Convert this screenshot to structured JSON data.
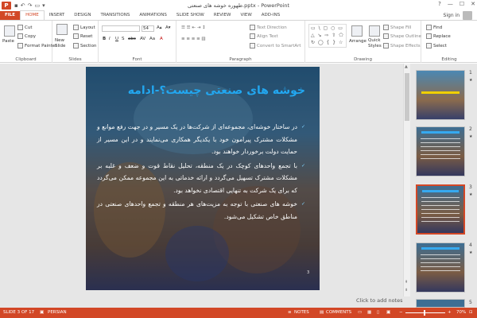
{
  "window": {
    "title": "طهوره خوشه های صنعتی.pptx - PowerPoint",
    "app_icon": "P",
    "min": "—",
    "max": "☐",
    "close": "✕",
    "help": "?"
  },
  "tabs": [
    {
      "label": "FILE"
    },
    {
      "label": "HOME"
    },
    {
      "label": "INSERT"
    },
    {
      "label": "DESIGN"
    },
    {
      "label": "TRANSITIONS"
    },
    {
      "label": "ANIMATIONS"
    },
    {
      "label": "SLIDE SHOW"
    },
    {
      "label": "REVIEW"
    },
    {
      "label": "VIEW"
    },
    {
      "label": "ADD-INS"
    }
  ],
  "signin": "Sign in",
  "ribbon": {
    "clipboard": {
      "label": "Clipboard",
      "paste": "Paste",
      "cut": "Cut",
      "copy": "Copy",
      "format_painter": "Format Painter"
    },
    "slides": {
      "label": "Slides",
      "new_slide": "New Slide",
      "layout": "Layout",
      "reset": "Reset",
      "section": "Section"
    },
    "font": {
      "label": "Font",
      "size": "54",
      "bold": "B",
      "italic": "I",
      "underline": "U",
      "strike": "S",
      "shadow": "abc",
      "spacing": "AV",
      "case": "Aa",
      "color": "A"
    },
    "paragraph": {
      "label": "Paragraph",
      "text_direction": "Text Direction",
      "align_text": "Align Text",
      "convert_smartart": "Convert to SmartArt"
    },
    "drawing": {
      "label": "Drawing",
      "arrange": "Arrange",
      "quick_styles": "Quick Styles",
      "shape_fill": "Shape Fill",
      "shape_outline": "Shape Outline",
      "shape_effects": "Shape Effects",
      "shapes_preview": "▭ \\ ▢ ○ ▭ △ ↘ ⇨ ⇧ ⬠ ↻ ◯ { } ☆"
    },
    "editing": {
      "label": "Editing",
      "find": "Find",
      "replace": "Replace",
      "select": "Select"
    }
  },
  "slide": {
    "title": "خوشه های صنعتی چیست؟-ادامه",
    "bullets": [
      "در ساختار خوشه‌ای، مجموعه‌ای از شرکت‌ها در یک مسیر و در جهت رفع موانع و مشکلات مشترک پیرامون خود با یکدیگر همکاری می‌نمایند و در این مسیر از حمایت دولت برخوردار خواهند بود.",
      "با تجمع واحدهای کوچک در یک منطقه، تحلیل نقاط قوت و ضعف و غلبه بر مشکلات مشترک تسهیل می‌گردد و ارائه خدماتی به این مجموعه ممکن می‌گردد که برای یک شرکت به تنهایی اقتصادی نخواهد بود.",
      "خوشه های صنعتی با توجه به مزیت‌های هر منطقه و تجمع واحدهای صنعتی در مناطق خاص تشکیل می‌شود."
    ],
    "number": "3"
  },
  "notes_hint": "Click to add notes",
  "thumbnails": [
    {
      "num": "1",
      "star": "★",
      "title": "طهوره خوشه های صنعتی"
    },
    {
      "num": "2",
      "star": "★",
      "title": ""
    },
    {
      "num": "3",
      "star": "★",
      "title": ""
    },
    {
      "num": "4",
      "star": "★",
      "title": ""
    },
    {
      "num": "5",
      "star": "",
      "title": ""
    }
  ],
  "status": {
    "slide_of": "SLIDE 3 OF 17",
    "language": "PERSIAN",
    "notes": "NOTES",
    "comments": "COMMENTS",
    "zoom": "70%",
    "zoom_minus": "−",
    "zoom_plus": "+",
    "fit": "⊡"
  },
  "colors": {
    "accent": "#d24726",
    "title_blue": "#22a7f0"
  }
}
